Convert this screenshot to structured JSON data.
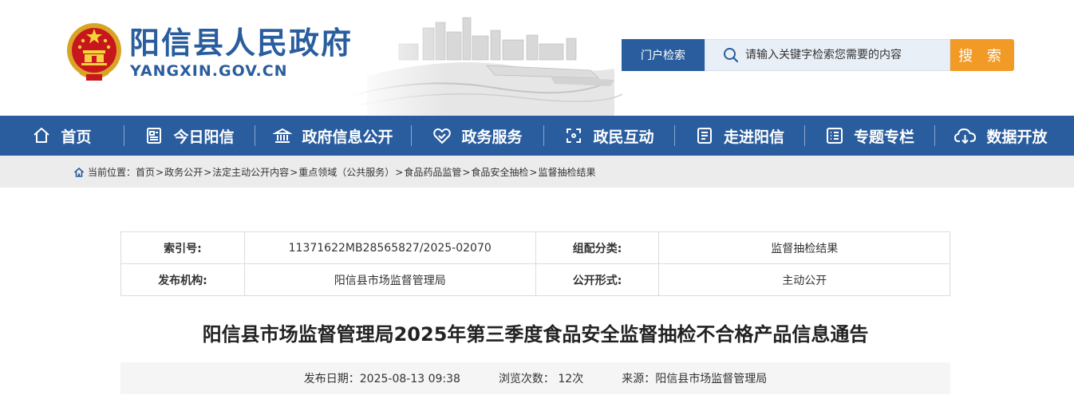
{
  "header": {
    "site_name": "阳信县人民政府",
    "site_domain": "YANGXIN.GOV.CN"
  },
  "search": {
    "scope_label": "门户检索",
    "placeholder": "请输入关键字检索您需要的内容",
    "button_label": "搜 索"
  },
  "nav": {
    "items": [
      {
        "label": "首页",
        "icon": "home-icon"
      },
      {
        "label": "今日阳信",
        "icon": "newspaper-icon"
      },
      {
        "label": "政府信息公开",
        "icon": "government-building-icon"
      },
      {
        "label": "政务服务",
        "icon": "handshake-heart-icon"
      },
      {
        "label": "政民互动",
        "icon": "interaction-arrows-icon"
      },
      {
        "label": "走进阳信",
        "icon": "document-list-icon"
      },
      {
        "label": "专题专栏",
        "icon": "checklist-icon"
      },
      {
        "label": "数据开放",
        "icon": "cloud-download-icon"
      }
    ]
  },
  "breadcrumb": {
    "prefix": "当前位置：",
    "items": [
      "首页",
      "政务公开",
      "法定主动公开内容",
      "重点领域（公共服务）",
      "食品药品监管",
      "食品安全抽检",
      "监督抽检结果"
    ],
    "separator": ">"
  },
  "info_table": {
    "rows": [
      [
        {
          "key": "索引号:",
          "value": "11371622MB28565827/2025-02070"
        },
        {
          "key": "组配分类:",
          "value": "监督抽检结果"
        }
      ],
      [
        {
          "key": "发布机构:",
          "value": "阳信县市场监督管理局"
        },
        {
          "key": "公开形式:",
          "value": "主动公开"
        }
      ]
    ]
  },
  "article": {
    "title": "阳信县市场监督管理局2025年第三季度食品安全监督抽检不合格产品信息通告",
    "publish_label": "发布日期：",
    "publish_date": "2025-08-13 09:38",
    "views_label": "浏览次数：",
    "views": "12次",
    "source_label": "来源：",
    "source": "阳信县市场监督管理局"
  },
  "colors": {
    "brand_blue": "#2a5d9e",
    "search_orange": "#f19a26",
    "breadcrumb_bg": "#ececec"
  }
}
